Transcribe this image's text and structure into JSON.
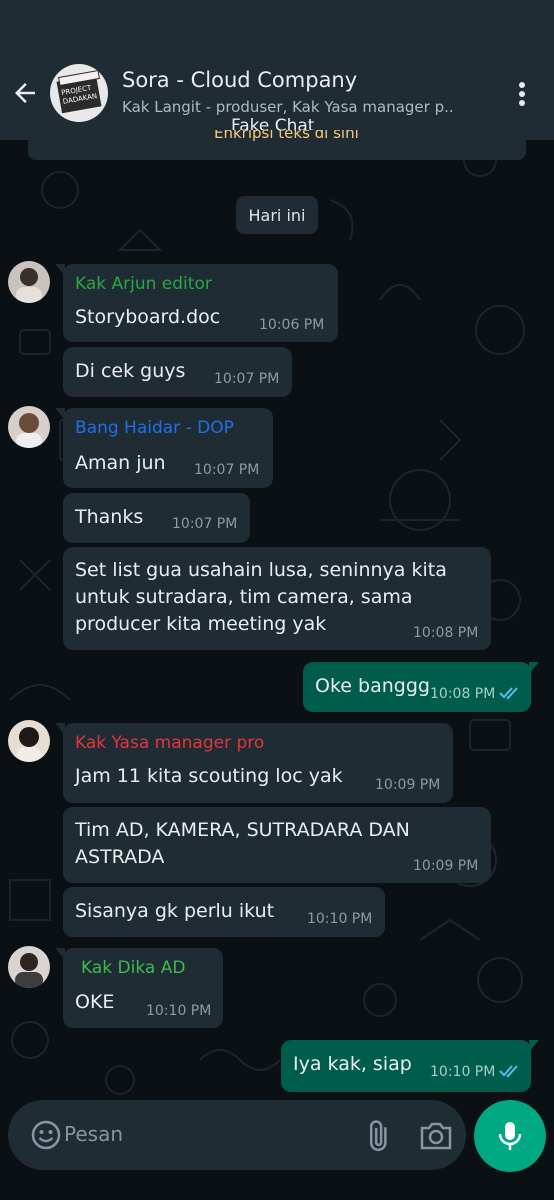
{
  "colors": {
    "background": "#0b1014",
    "header": "#1f2c33",
    "incoming_bubble": "#1f2c33",
    "outgoing_bubble": "#005c4b",
    "accent": "#00a884",
    "read_ticks": "#53bdeb"
  },
  "header": {
    "title": "Sora - Cloud Company",
    "subtitle": "Kak Langit - produser, Kak Yasa manager p..",
    "watermark": "Fake Chat",
    "avatar_text_line1": "PROJECT",
    "avatar_text_line2": "DADAKAN"
  },
  "encryption_banner": "Enkripsi teks di sini",
  "date_chip": "Hari ini",
  "messages": [
    {
      "sender": "Kak Arjun editor",
      "sender_color": "#27a745",
      "text": "Storyboard.doc",
      "time": "10:06 PM"
    },
    {
      "text": "Di cek guys",
      "time": "10:07 PM"
    },
    {
      "sender": "Bang Haidar - DOP",
      "sender_color": "#1f6feb",
      "text": "Aman jun",
      "time": "10:07 PM"
    },
    {
      "text": "Thanks",
      "time": "10:07 PM"
    },
    {
      "text_lines": [
        "Set list gua usahain lusa, seninnya kita",
        "untuk sutradara, tim camera, sama",
        "producer kita meeting yak"
      ],
      "time": "10:08 PM"
    },
    {
      "outgoing": true,
      "text": "Oke banggg",
      "time": "10:08 PM"
    },
    {
      "sender": "Kak Yasa manager pro",
      "sender_color": "#e5343d",
      "text": "Jam 11 kita scouting loc yak",
      "time": "10:09 PM"
    },
    {
      "text_lines": [
        "Tim AD, KAMERA, SUTRADARA DAN",
        "ASTRADA"
      ],
      "time": "10:09 PM"
    },
    {
      "text": "Sisanya gk perlu ikut",
      "time": "10:10 PM"
    },
    {
      "sender": "Kak Dika AD",
      "sender_color": "#3fb950",
      "text": "OKE",
      "time": "10:10 PM"
    },
    {
      "outgoing": true,
      "text": "Iya kak, siap",
      "time": "10:10 PM"
    }
  ],
  "input": {
    "placeholder": "Pesan"
  },
  "icons": [
    "back-arrow-icon",
    "more-vert-icon",
    "emoji-icon",
    "attach-icon",
    "camera-icon",
    "mic-icon",
    "double-check-icon"
  ]
}
